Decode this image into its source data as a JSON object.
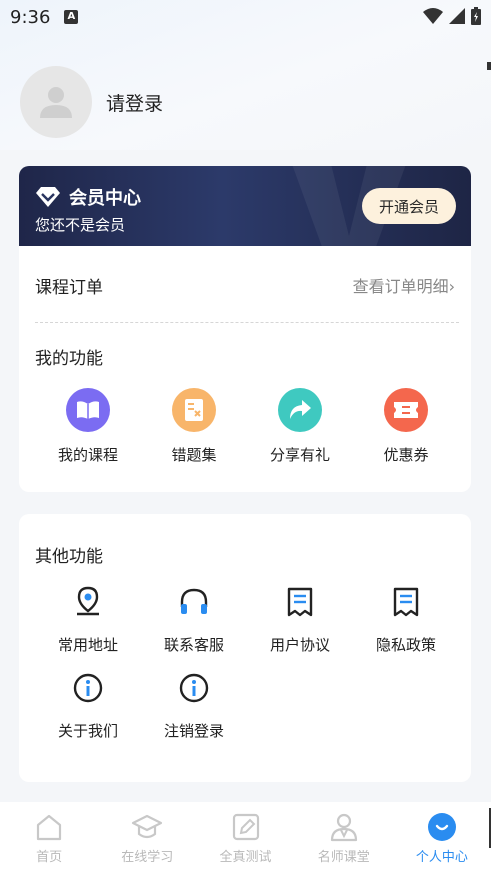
{
  "status_bar": {
    "time": "9:36",
    "notification_icon": "A"
  },
  "profile": {
    "login_text": "请登录"
  },
  "member": {
    "title": "会员中心",
    "subtitle": "您还不是会员",
    "open_button": "开通会员"
  },
  "orders": {
    "title": "课程订单",
    "link": "查看订单明细"
  },
  "my_functions": {
    "title": "我的功能",
    "items": [
      {
        "label": "我的课程",
        "icon": "book-icon",
        "color": "#7b6cf2"
      },
      {
        "label": "错题集",
        "icon": "notebook-icon",
        "color": "#f8b56a"
      },
      {
        "label": "分享有礼",
        "icon": "share-icon",
        "color": "#3fc9c0"
      },
      {
        "label": "优惠券",
        "icon": "coupon-icon",
        "color": "#f4674d"
      }
    ]
  },
  "other_functions": {
    "title": "其他功能",
    "items": [
      {
        "label": "常用地址",
        "icon": "location-icon"
      },
      {
        "label": "联系客服",
        "icon": "headset-icon"
      },
      {
        "label": "用户协议",
        "icon": "document-icon"
      },
      {
        "label": "隐私政策",
        "icon": "document-icon"
      },
      {
        "label": "关于我们",
        "icon": "info-icon"
      },
      {
        "label": "注销登录",
        "icon": "info-icon"
      }
    ]
  },
  "tabbar": {
    "tabs": [
      {
        "label": "首页",
        "icon": "home-icon"
      },
      {
        "label": "在线学习",
        "icon": "graduation-cap-icon"
      },
      {
        "label": "全真测试",
        "icon": "pencil-icon"
      },
      {
        "label": "名师课堂",
        "icon": "teacher-icon"
      },
      {
        "label": "个人中心",
        "icon": "profile-icon",
        "active": true
      }
    ],
    "active_color": "#2a8cf0",
    "inactive_color": "#b9b9b9"
  }
}
